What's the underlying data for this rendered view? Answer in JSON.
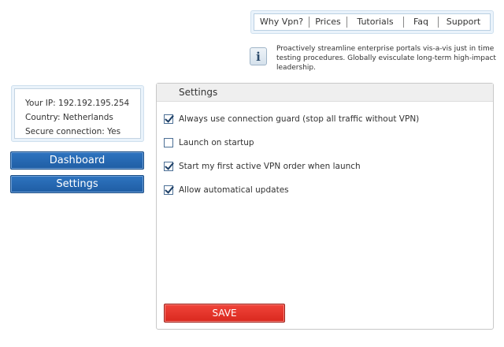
{
  "nav": {
    "items": [
      {
        "label": "Why Vpn?"
      },
      {
        "label": "Prices"
      },
      {
        "label": "Tutorials"
      },
      {
        "label": "Faq"
      },
      {
        "label": "Support"
      }
    ]
  },
  "info": {
    "icon": "info-icon",
    "glyph": "i",
    "text": "Proactively streamline enterprise portals vis-a-vis just in time testing procedures. Globally evisculate long-term high-impact leadership."
  },
  "status": {
    "ip": "Your IP: 192.192.195.254",
    "country": "Country: Netherlands",
    "secure": "Secure connection: Yes"
  },
  "sidebar": {
    "dashboard_label": "Dashboard",
    "settings_label": "Settings"
  },
  "settings": {
    "title": "Settings",
    "options": [
      {
        "label": "Always use connection guard (stop all traffic without VPN)",
        "checked": true
      },
      {
        "label": "Launch on startup",
        "checked": false
      },
      {
        "label": "Start my first active VPN order when launch",
        "checked": true
      },
      {
        "label": "Allow automatical updates",
        "checked": true
      }
    ],
    "save_label": "SAVE"
  },
  "colors": {
    "primary_button": "#2467b3",
    "save_button": "#e8362c",
    "panel_border": "#c8c8c8"
  }
}
